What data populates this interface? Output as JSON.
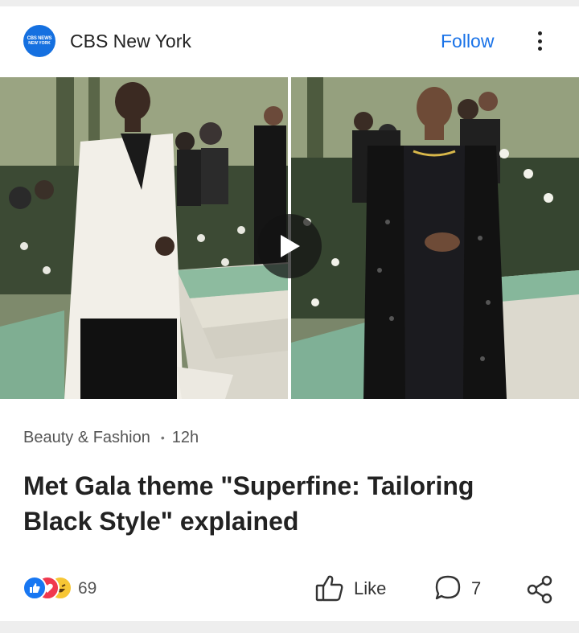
{
  "source": {
    "logo_line1": "CBS NEWS",
    "logo_line2": "NEW YORK",
    "name": "CBS New York",
    "follow_label": "Follow"
  },
  "media": {
    "left_image_icon": "photo-man-white-suit",
    "right_image_icon": "photo-man-black-coat",
    "play_icon": "play-icon"
  },
  "article": {
    "category": "Beauty & Fashion",
    "age": "12h",
    "headline": "Met Gala theme \"Superfine: Tailoring Black Style\" explained"
  },
  "engagement": {
    "reaction_icons": [
      "like-reaction-icon",
      "love-reaction-icon",
      "haha-reaction-icon"
    ],
    "reaction_count": "69",
    "like_label": "Like",
    "comment_count": "7"
  },
  "colors": {
    "accent": "#1a73e8",
    "logo": "#1570e0",
    "text_primary": "#222222",
    "text_secondary": "#555555"
  }
}
